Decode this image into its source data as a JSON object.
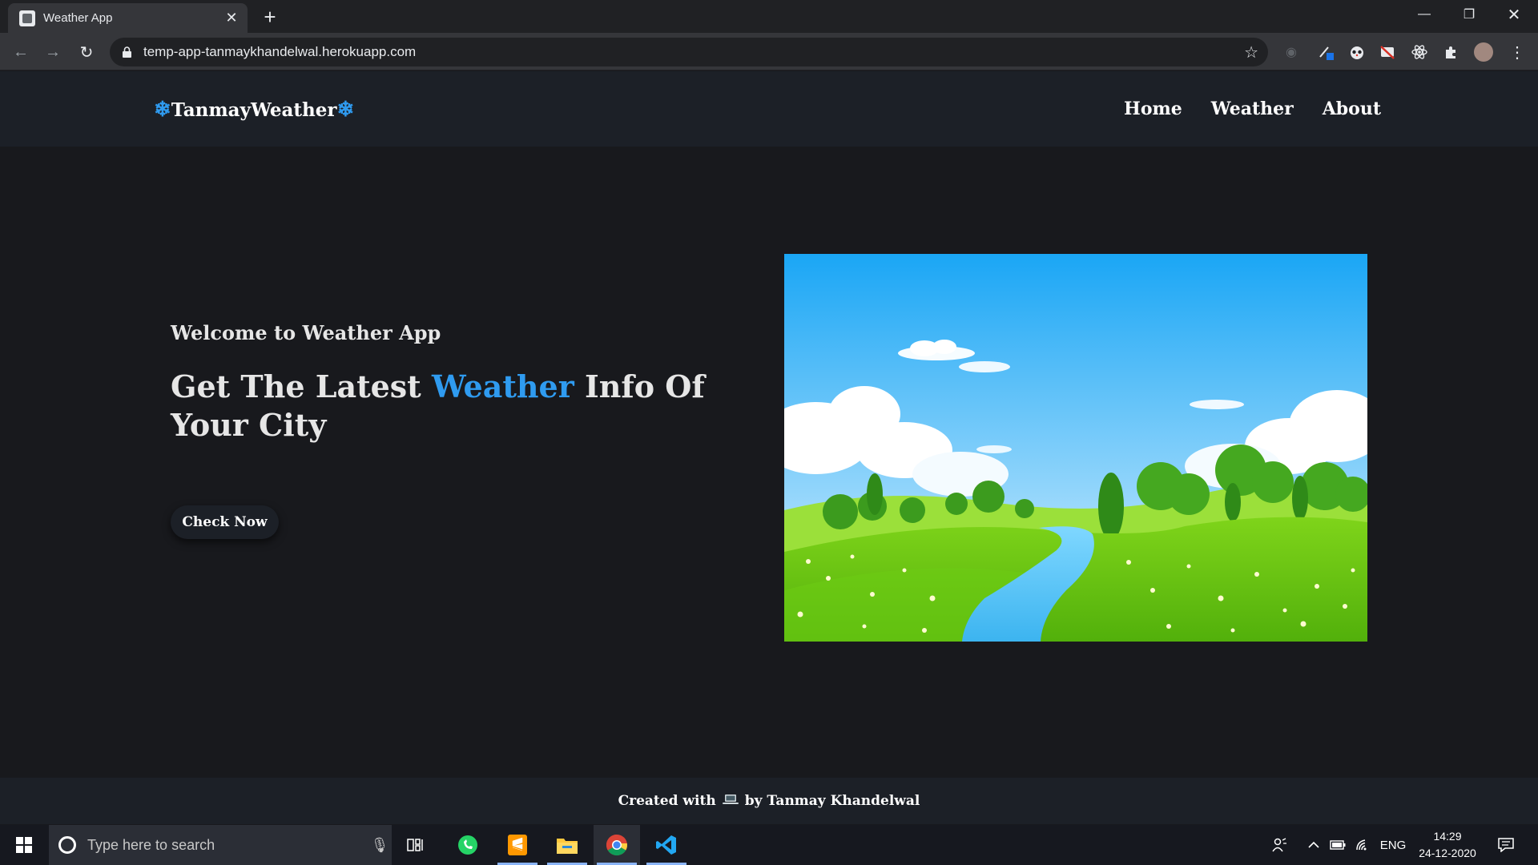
{
  "browser": {
    "tab_title": "Weather App",
    "url": "temp-app-tanmaykhandelwal.herokuapp.com"
  },
  "site": {
    "brand": "TanmayWeather",
    "nav": [
      "Home",
      "Weather",
      "About"
    ],
    "hero": {
      "subtitle": "Welcome to Weather App",
      "title_before": "Get The Latest",
      "title_accent": "Weather",
      "title_after": "Info Of Your City",
      "cta_label": "Check Now"
    },
    "footer": {
      "before": "Created with",
      "after": "by Tanmay Khandelwal"
    },
    "accent_color": "#2f9bf0"
  },
  "taskbar": {
    "search_placeholder": "Type here to search",
    "language": "ENG",
    "time": "14:29",
    "date": "24-12-2020"
  }
}
